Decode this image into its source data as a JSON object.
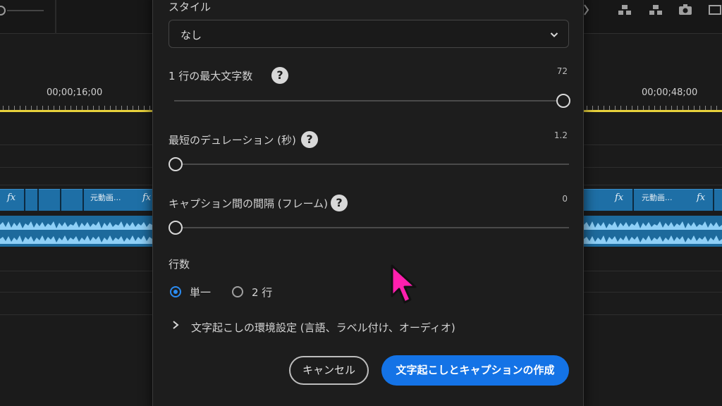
{
  "timeline": {
    "timecode_left": "00;00;16;00",
    "timecode_right": "00;00;48;00",
    "clip_label": "元動画...",
    "fx_label": "fx",
    "playhead_color": "#e8d23c",
    "clip_color": "#1e6fa6"
  },
  "dialog": {
    "style": {
      "label": "スタイル",
      "value": "なし",
      "icon": "chevron-down-icon"
    },
    "max_chars": {
      "label": "1 行の最大文字数",
      "help": "?",
      "value": "72",
      "level": 1.0
    },
    "min_duration": {
      "label": "最短のデュレーション (秒)",
      "help": "?",
      "value": "1.2",
      "level": 0.0
    },
    "caption_gap": {
      "label": "キャプション間の間隔 (フレーム)",
      "help": "?",
      "value": "0",
      "level": 0.0
    },
    "lines": {
      "label": "行数",
      "options": [
        {
          "label": "単一",
          "selected": true
        },
        {
          "label": "2 行",
          "selected": false
        }
      ]
    },
    "transcription_prefs": {
      "label": "文字起こしの環境設定 (言語、ラベル付け、オーディオ)",
      "icon": "chevron-right-icon"
    },
    "cancel_label": "キャンセル",
    "create_label": "文字起こしとキャプションの作成",
    "accent_color": "#1473e6"
  },
  "cursor": {
    "icon": "pointer-cursor-icon",
    "color": "#ff1fae"
  }
}
